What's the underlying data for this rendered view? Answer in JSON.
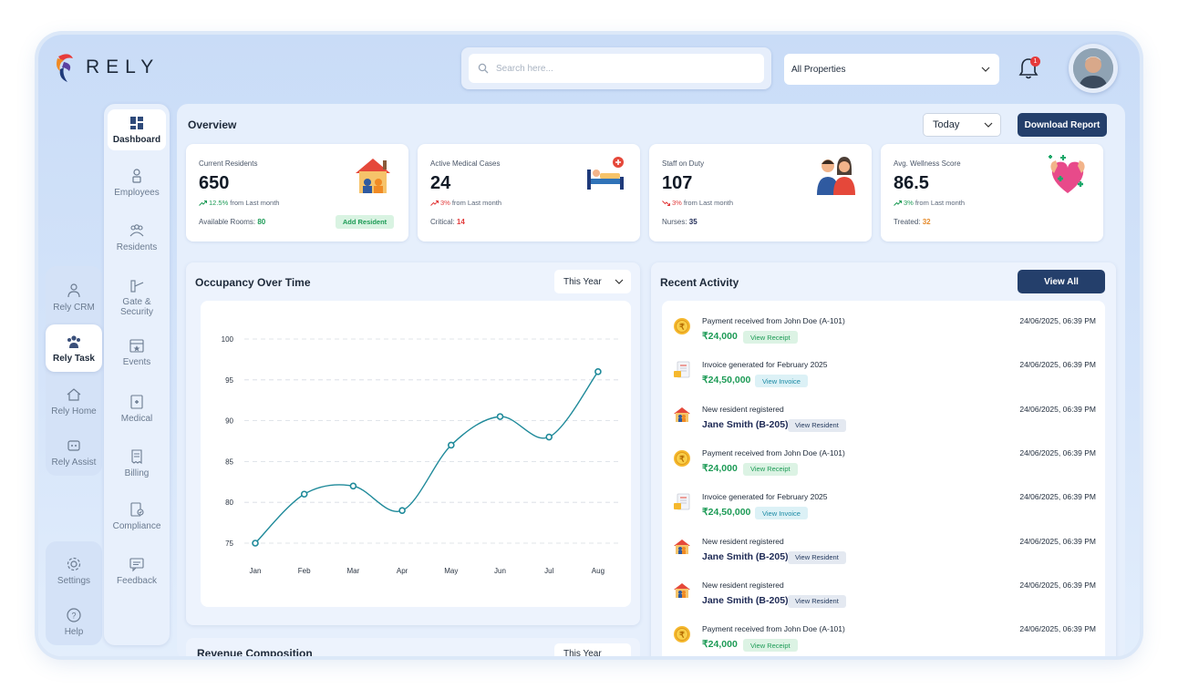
{
  "brand": {
    "name": "RELY"
  },
  "header": {
    "search_placeholder": "Search here...",
    "property_select": "All Properties",
    "notification_count": "1"
  },
  "rail": {
    "items": [
      {
        "label": "Rely CRM",
        "icon": "crm-icon"
      },
      {
        "label": "Rely Task",
        "icon": "task-icon",
        "active": true
      },
      {
        "label": "Rely Home",
        "icon": "home-icon"
      },
      {
        "label": "Rely Assist",
        "icon": "assist-icon"
      }
    ],
    "bottom": [
      {
        "label": "Settings",
        "icon": "gear-icon"
      },
      {
        "label": "Help",
        "icon": "help-icon"
      }
    ]
  },
  "sidebar": {
    "items": [
      {
        "label": "Dashboard",
        "icon": "dashboard-icon",
        "active": true
      },
      {
        "label": "Employees",
        "icon": "employees-icon"
      },
      {
        "label": "Residents",
        "icon": "residents-icon"
      },
      {
        "label": "Gate & Security",
        "icon": "gate-icon"
      },
      {
        "label": "Events",
        "icon": "events-icon"
      },
      {
        "label": "Medical",
        "icon": "medical-icon"
      },
      {
        "label": "Billing",
        "icon": "billing-icon"
      },
      {
        "label": "Compliance",
        "icon": "compliance-icon"
      },
      {
        "label": "Feedback",
        "icon": "feedback-icon"
      }
    ]
  },
  "overview": {
    "title": "Overview",
    "range": "Today",
    "download_label": "Download Report",
    "cards": [
      {
        "label": "Current Residents",
        "value": "650",
        "trend": "12.5%",
        "trend_text": "from Last month",
        "direction": "up",
        "sub_label": "Available Rooms:",
        "sub_value": "80",
        "action": "Add Resident",
        "illustration": "house-icon"
      },
      {
        "label": "Active Medical Cases",
        "value": "24",
        "trend": "3%",
        "trend_text": "from Last month",
        "direction": "down",
        "sub_label": "Critical:",
        "sub_value": "14",
        "illustration": "hospital-bed-icon"
      },
      {
        "label": "Staff on Duty",
        "value": "107",
        "trend": "3%",
        "trend_text": "from Last month",
        "direction": "down",
        "sub_label": "Nurses:",
        "sub_value": "35",
        "illustration": "staff-icon"
      },
      {
        "label": "Avg. Wellness Score",
        "value": "86.5",
        "trend": "3%",
        "trend_text": "from Last month",
        "direction": "up",
        "sub_label": "Treated:",
        "sub_value": "32",
        "illustration": "wellness-heart-icon"
      }
    ]
  },
  "occupancy": {
    "title": "Occupancy Over Time",
    "range": "This Year"
  },
  "chart_data": {
    "type": "line",
    "categories": [
      "Jan",
      "Feb",
      "Mar",
      "Apr",
      "May",
      "Jun",
      "Jul",
      "Aug"
    ],
    "values": [
      75,
      81,
      82,
      79,
      87,
      90.5,
      88,
      96
    ],
    "yticks": [
      75,
      80,
      85,
      90,
      95,
      100
    ],
    "ylim": [
      75,
      100
    ],
    "grid": true,
    "color": "#1f8a9a"
  },
  "activity": {
    "title": "Recent Activity",
    "view_all": "View All",
    "items": [
      {
        "kind": "payment",
        "title": "Payment received from John Doe (A-101)",
        "time": "24/06/2025, 06:39 PM",
        "amount": "₹24,000",
        "action": "View Receipt"
      },
      {
        "kind": "invoice",
        "title": "Invoice generated for February 2025",
        "time": "24/06/2025, 06:39 PM",
        "amount": "₹24,50,000",
        "action": "View Invoice"
      },
      {
        "kind": "resident",
        "title": "New resident registered",
        "time": "24/06/2025, 06:39 PM",
        "amount": "Jane Smith (B-205)",
        "action": "View Resident"
      },
      {
        "kind": "payment",
        "title": "Payment received from John Doe (A-101)",
        "time": "24/06/2025, 06:39 PM",
        "amount": "₹24,000",
        "action": "View Receipt"
      },
      {
        "kind": "invoice",
        "title": "Invoice generated for February 2025",
        "time": "24/06/2025, 06:39 PM",
        "amount": "₹24,50,000",
        "action": "View Invoice"
      },
      {
        "kind": "resident",
        "title": "New resident registered",
        "time": "24/06/2025, 06:39 PM",
        "amount": "Jane Smith (B-205)",
        "action": "View Resident"
      },
      {
        "kind": "resident",
        "title": "New resident registered",
        "time": "24/06/2025, 06:39 PM",
        "amount": "Jane Smith (B-205)",
        "action": "View Resident"
      },
      {
        "kind": "payment",
        "title": "Payment received from John Doe (A-101)",
        "time": "24/06/2025, 06:39 PM",
        "amount": "₹24,000",
        "action": "View Receipt"
      }
    ]
  },
  "revenue": {
    "title": "Revenue Composition",
    "range": "This Year"
  }
}
